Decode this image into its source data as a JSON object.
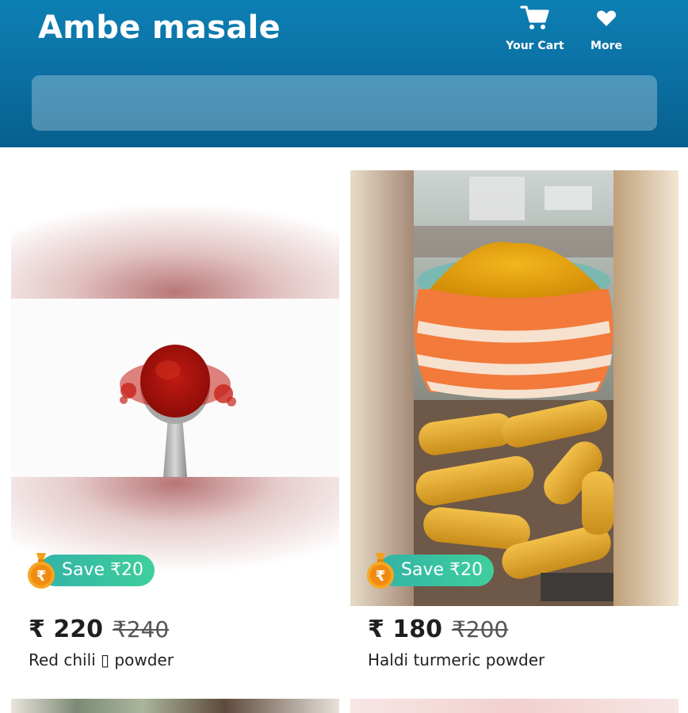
{
  "header": {
    "title": "Ambe masale",
    "cart_label": "Your Cart",
    "more_label": "More",
    "cart_icon": "cart-icon",
    "more_icon": "heart-icon"
  },
  "search": {
    "placeholder": ""
  },
  "products": [
    {
      "name": "Red chili ▯ powder",
      "price": "₹ 220",
      "original_price": "₹240",
      "save_label": "Save ₹20",
      "image": "red chili powder on spoon"
    },
    {
      "name": "Haldi turmeric powder",
      "price": "₹ 180",
      "original_price": "₹200",
      "save_label": "Save ₹20",
      "image": "turmeric powder in striped pot with turmeric roots"
    }
  ],
  "colors": {
    "header": "#0b6fa2",
    "save_badge": "#3fcf9b",
    "coin": "#f5a623"
  }
}
